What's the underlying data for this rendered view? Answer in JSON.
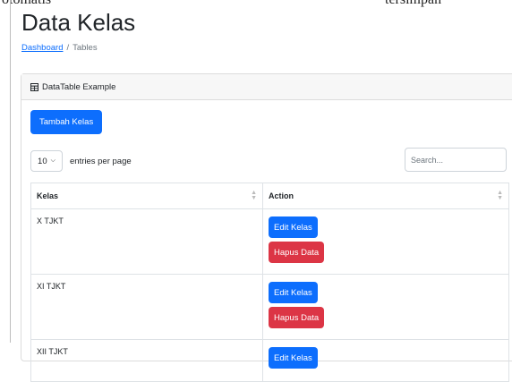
{
  "top_fragments": {
    "left": "otomatis",
    "right": "tersimpan"
  },
  "page": {
    "title": "Data Kelas"
  },
  "breadcrumb": {
    "link": "Dashboard",
    "separator": "/",
    "current": "Tables"
  },
  "card": {
    "header": "DataTable Example"
  },
  "toolbar": {
    "add_label": "Tambah Kelas"
  },
  "table_controls": {
    "entries_value": "10",
    "entries_suffix": "entries per page",
    "search_placeholder": "Search..."
  },
  "table": {
    "headers": [
      "Kelas",
      "Action"
    ],
    "rows": [
      {
        "kelas": "X TJKT",
        "edit": "Edit Kelas",
        "delete": "Hapus Data"
      },
      {
        "kelas": "XI TJKT",
        "edit": "Edit Kelas",
        "delete": "Hapus Data"
      },
      {
        "kelas": "XII TJKT",
        "edit": "Edit Kelas"
      }
    ]
  },
  "colors": {
    "primary": "#0d6efd",
    "danger": "#dc3545"
  }
}
